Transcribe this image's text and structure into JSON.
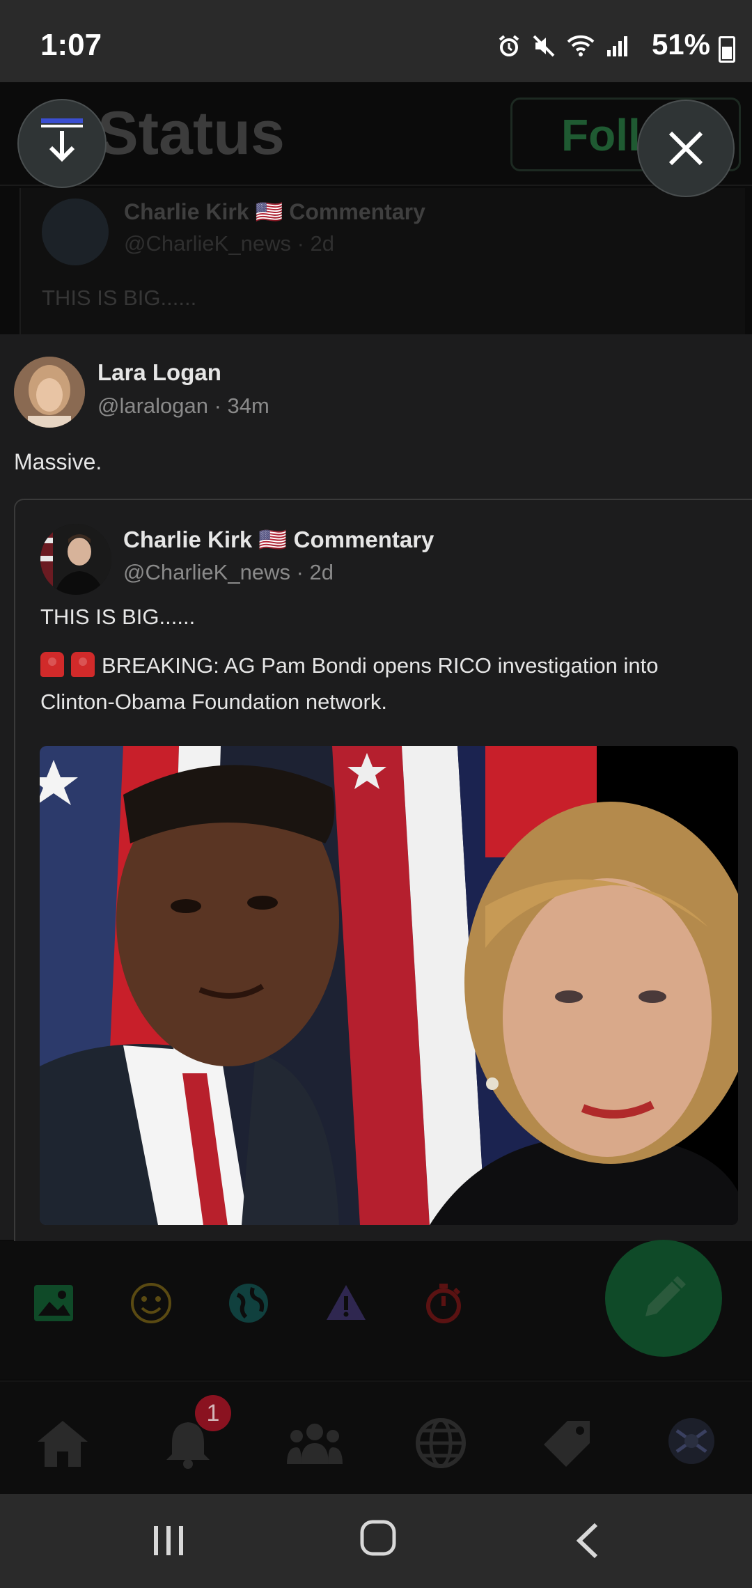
{
  "status_bar": {
    "time": "1:07",
    "battery": "51%"
  },
  "background": {
    "title": "Status",
    "follow_label": "Foll",
    "quoted_name": "Charlie Kirk 🇺🇸 Commentary",
    "quoted_handle": "@CharlieK_news · 2d",
    "quoted_text": "THIS IS BIG......"
  },
  "post": {
    "author_name": "Lara Logan",
    "author_handle": "@laralogan · 34m",
    "text": "Massive.",
    "quote": {
      "author_name": "Charlie Kirk 🇺🇸 Commentary",
      "author_handle": "@CharlieK_news · 2d",
      "line1": "THIS IS BIG......",
      "line2": "BREAKING: AG Pam Bondi opens RICO investigation into Clinton-Obama Foundation network."
    }
  },
  "nav": {
    "notification_count": "1"
  },
  "colors": {
    "accent_green": "#1f7a45",
    "card_bg": "#1c1c1d",
    "badge_red": "#8a1220"
  }
}
